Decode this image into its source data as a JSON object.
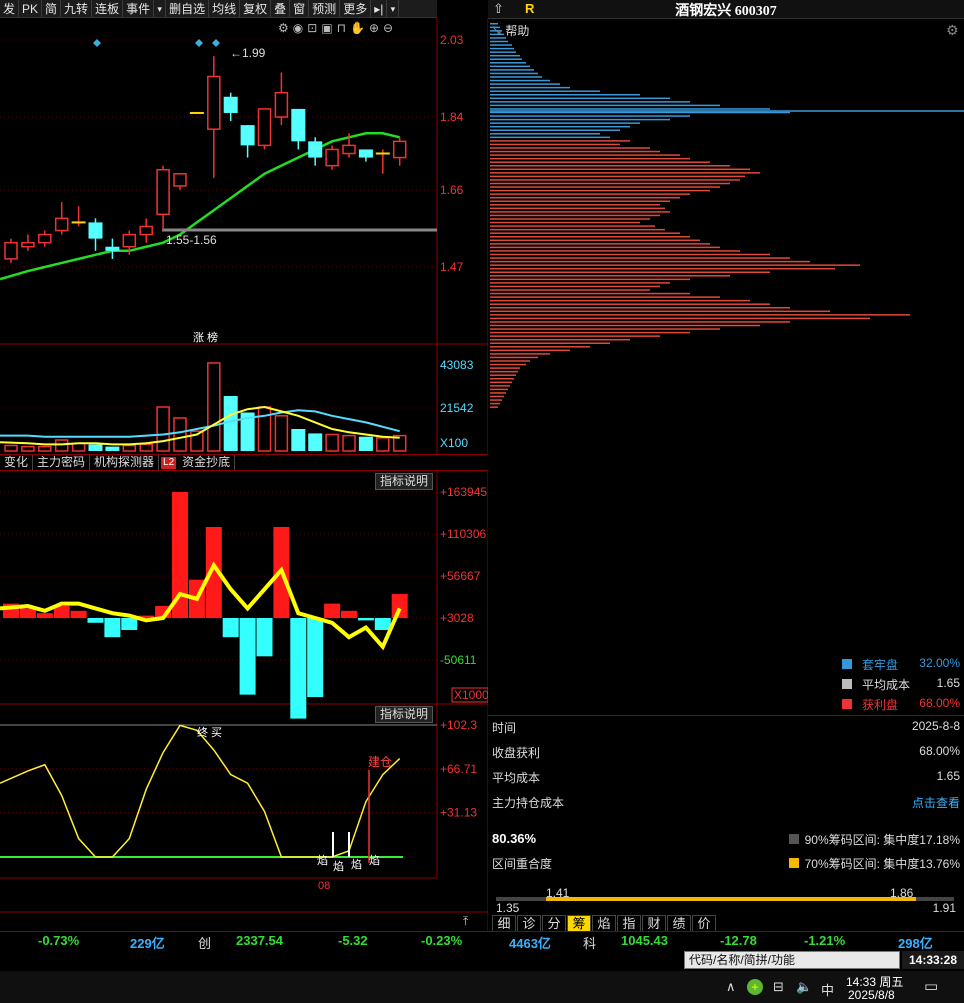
{
  "toolbar": {
    "items": [
      "发",
      "PK",
      "简",
      "九转",
      "连板",
      "事件",
      "▾",
      "删自选",
      "均线",
      "复权",
      "叠",
      "窗",
      "预测",
      "更多",
      "▸|",
      "▾"
    ]
  },
  "chart_toolbar_icons": [
    "settings-icon",
    "eye-icon",
    "shopping-basket-icon",
    "save-icon",
    "lock-icon",
    "hand-icon",
    "zoom-in-icon",
    "zoom-out-icon"
  ],
  "title": {
    "arrow": "⇧",
    "r_label": "R",
    "stock": "酒钢宏兴 600307"
  },
  "help": "帮助",
  "price_axis": [
    "2.03",
    "1.84",
    "1.66",
    "1.47"
  ],
  "price_annotations": {
    "high": "1.99",
    "range": "1.55-1.56"
  },
  "zhangbang": "涨 榜",
  "volume_axis": [
    "43083",
    "21542",
    "X100"
  ],
  "indicator_tabs": [
    "变化",
    "主力密码",
    "机构探测器",
    "L2",
    "资金抄底"
  ],
  "indicator_btn_1": "指标说明",
  "indicator_btn_2": "指标说明",
  "macd_axis": [
    "+163945",
    "+110306",
    "+56667",
    "+3028",
    "-50611",
    "X1000"
  ],
  "osc_axis": [
    "+102.3",
    "+66.71",
    "+31.13"
  ],
  "osc_labels": {
    "top": "终 买",
    "build": "建仓",
    "bottom1": "焰",
    "bottom2": "焰",
    "bottom3": "焰",
    "bottom4": "焰",
    "date": "08"
  },
  "chip_legend": [
    {
      "label": "套牢盘",
      "value": "32.00%",
      "color": "#3399dd"
    },
    {
      "label": "平均成本",
      "value": "1.65",
      "color": "#bbbbbb"
    },
    {
      "label": "获利盘",
      "value": "68.00%",
      "color": "#ee3333"
    }
  ],
  "chip_info": [
    {
      "key": "时间",
      "value": "2025-8-8"
    },
    {
      "key": "收盘获利",
      "value": "68.00%"
    },
    {
      "key": "平均成本",
      "value": "1.65"
    },
    {
      "key": "主力持仓成本",
      "value": "点击查看"
    }
  ],
  "concentration": {
    "percent": "80.36%",
    "row90": "90%筹码区间: 集中度17.18%",
    "overlap_label": "区间重合度",
    "row70": "70%筹码区间: 集中度13.76%"
  },
  "range_bar": {
    "low_axis": "1.35",
    "high_axis": "1.91",
    "low70": "1.41",
    "high70": "1.86"
  },
  "right_tabs": [
    "细",
    "诊",
    "分",
    "筹",
    "焰",
    "指",
    "财",
    "绩",
    "价"
  ],
  "right_tab_active": "筹",
  "status": {
    "a": "-0.73%",
    "b": "229亿",
    "c_label": "创",
    "c_val": "2337.54",
    "c_chg": "-5.32",
    "c_pct": "-0.23%",
    "d": "4463亿",
    "e_label": "科",
    "e_val": "1045.43",
    "e_chg": "-12.78",
    "e_pct": "-1.21%",
    "f": "298亿"
  },
  "search_placeholder": "代码/名称/简拼/功能",
  "clock": "14:33:28",
  "taskbar": {
    "time": "14:33 周五",
    "date": "2025/8/8",
    "ime": "中"
  },
  "chart_data": {
    "type": "candlestick",
    "ylim": [
      1.4,
      2.05
    ],
    "candles": [
      {
        "o": 1.49,
        "c": 1.53,
        "h": 1.54,
        "l": 1.48
      },
      {
        "o": 1.52,
        "c": 1.53,
        "h": 1.55,
        "l": 1.51
      },
      {
        "o": 1.53,
        "c": 1.55,
        "h": 1.56,
        "l": 1.52
      },
      {
        "o": 1.56,
        "c": 1.59,
        "h": 1.63,
        "l": 1.55
      },
      {
        "o": 1.58,
        "c": 1.58,
        "h": 1.62,
        "l": 1.57
      },
      {
        "o": 1.58,
        "c": 1.54,
        "h": 1.59,
        "l": 1.51
      },
      {
        "o": 1.52,
        "c": 1.51,
        "h": 1.54,
        "l": 1.49
      },
      {
        "o": 1.52,
        "c": 1.55,
        "h": 1.56,
        "l": 1.5
      },
      {
        "o": 1.55,
        "c": 1.57,
        "h": 1.59,
        "l": 1.53
      },
      {
        "o": 1.6,
        "c": 1.71,
        "h": 1.72,
        "l": 1.56
      },
      {
        "o": 1.67,
        "c": 1.7,
        "h": 1.7,
        "l": 1.66
      },
      {
        "o": 1.85,
        "c": 1.85,
        "h": 1.85,
        "l": 1.85
      },
      {
        "o": 1.81,
        "c": 1.94,
        "h": 1.99,
        "l": 1.69
      },
      {
        "o": 1.89,
        "c": 1.85,
        "h": 1.9,
        "l": 1.83
      },
      {
        "o": 1.82,
        "c": 1.77,
        "h": 1.82,
        "l": 1.74
      },
      {
        "o": 1.77,
        "c": 1.86,
        "h": 1.86,
        "l": 1.76
      },
      {
        "o": 1.84,
        "c": 1.9,
        "h": 1.95,
        "l": 1.82
      },
      {
        "o": 1.86,
        "c": 1.78,
        "h": 1.86,
        "l": 1.76
      },
      {
        "o": 1.78,
        "c": 1.74,
        "h": 1.79,
        "l": 1.72
      },
      {
        "o": 1.72,
        "c": 1.76,
        "h": 1.77,
        "l": 1.71
      },
      {
        "o": 1.75,
        "c": 1.77,
        "h": 1.8,
        "l": 1.74
      },
      {
        "o": 1.76,
        "c": 1.74,
        "h": 1.76,
        "l": 1.73
      },
      {
        "o": 1.75,
        "c": 1.75,
        "h": 1.76,
        "l": 1.7
      },
      {
        "o": 1.74,
        "c": 1.78,
        "h": 1.79,
        "l": 1.72
      }
    ],
    "ma": [
      1.44,
      1.46,
      1.47,
      1.48,
      1.49,
      1.5,
      1.51,
      1.51,
      1.52,
      1.53,
      1.55,
      1.58,
      1.61,
      1.64,
      1.67,
      1.7,
      1.72,
      1.74,
      1.76,
      1.78,
      1.79,
      1.8,
      1.8,
      1.79
    ],
    "volume": [
      5,
      4,
      4,
      10,
      7,
      6,
      4,
      5,
      6,
      40,
      30,
      18,
      80,
      50,
      35,
      40,
      32,
      20,
      16,
      15,
      14,
      13,
      12,
      14
    ],
    "volume_ma1": [
      8,
      7,
      6,
      6,
      7,
      7,
      6,
      6,
      7,
      9,
      12,
      15,
      24,
      33,
      38,
      40,
      36,
      32,
      26,
      20,
      17,
      15,
      13,
      12
    ],
    "volume_ma2": [
      14,
      14,
      13,
      13,
      13,
      13,
      13,
      13,
      14,
      15,
      17,
      20,
      23,
      27,
      30,
      32,
      35,
      37,
      36,
      32,
      29,
      26,
      22,
      18
    ],
    "macd_bars": [
      30,
      20,
      10,
      25,
      15,
      -10,
      -40,
      -25,
      5,
      25,
      263,
      80,
      190,
      -40,
      -160,
      -80,
      190,
      -210,
      -165,
      30,
      15,
      -5,
      -25,
      50
    ],
    "macd_line": [
      20,
      25,
      15,
      30,
      30,
      20,
      10,
      5,
      -5,
      0,
      50,
      40,
      110,
      60,
      20,
      60,
      100,
      10,
      0,
      -10,
      -40,
      -20,
      -60,
      20
    ],
    "osc": [
      55,
      65,
      70,
      45,
      10,
      -5,
      -5,
      10,
      50,
      80,
      102,
      98,
      82,
      62,
      55,
      32,
      -5,
      -5,
      -5,
      -5,
      0,
      40,
      62,
      75
    ]
  }
}
